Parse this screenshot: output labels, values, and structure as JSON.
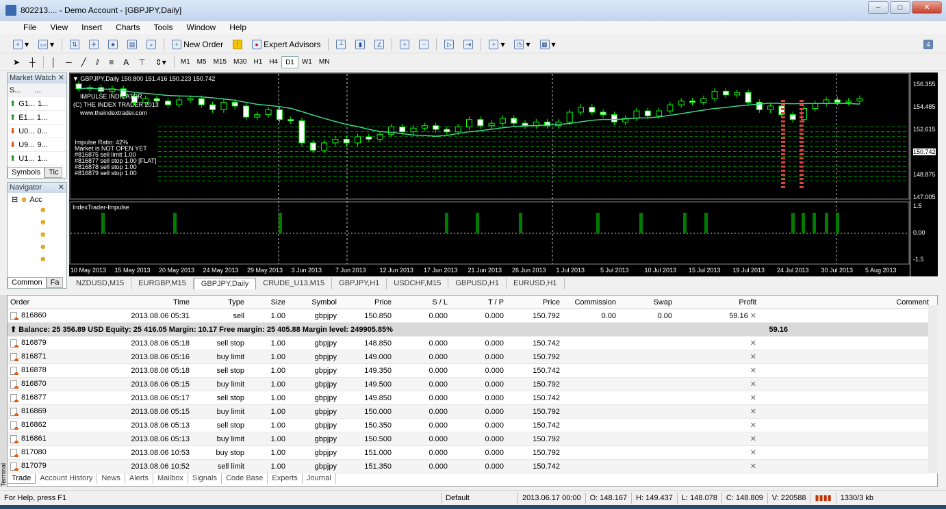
{
  "window": {
    "title": "802213.... - Demo Account - [GBPJPY,Daily]",
    "controls": [
      "–",
      "□",
      "✕"
    ]
  },
  "menu": [
    "File",
    "View",
    "Insert",
    "Charts",
    "Tools",
    "Window",
    "Help"
  ],
  "toolbar1": {
    "new_order": "New Order",
    "expert_advisors": "Expert Advisors"
  },
  "toolbar2": {
    "timeframes": [
      "M1",
      "M5",
      "M15",
      "M30",
      "H1",
      "H4",
      "D1",
      "W1",
      "MN"
    ],
    "selected": "D1",
    "text_tool": "A"
  },
  "market_watch": {
    "title": "Market Watch",
    "col_symbol": "S...",
    "col_price": "...",
    "rows": [
      {
        "sym": "G1...",
        "val": "1...",
        "dir": "up"
      },
      {
        "sym": "E1...",
        "val": "1...",
        "dir": "up"
      },
      {
        "sym": "U0...",
        "val": "0...",
        "dir": "down"
      },
      {
        "sym": "U9...",
        "val": "9...",
        "dir": "down"
      },
      {
        "sym": "U1...",
        "val": "1...",
        "dir": "up"
      }
    ],
    "tabs": [
      "Symbols",
      "Tic"
    ]
  },
  "navigator": {
    "title": "Navigator",
    "root": "Acc",
    "tabs": [
      "Common",
      "Fa"
    ]
  },
  "chart": {
    "header": "GBPJPY,Daily  150.800 151.416 150.223 150.742",
    "indicator_lines": [
      "IMPULSE INDICATOR",
      "(C) THE INDEX TRADER 2013",
      "www.theindextrader.com"
    ],
    "order_labels": [
      "#816879 sell stop 1.00",
      "#816878 sell stop 1.00",
      "#816877 sell stop 1.00 [FLAT]",
      "#816875 sell limit 1.00",
      "Market is NOT OPEN YET",
      "Impulse Ratio: 42%"
    ],
    "sub_title": "IndexTrader-Impulse",
    "price_axis": [
      "156.355",
      "154.485",
      "152.615",
      "150.742",
      "148.875",
      "147.005"
    ],
    "current_price": "150.742",
    "sub_axis": [
      "1.5",
      "0.00",
      "-1.5"
    ],
    "dates": [
      "10 May 2013",
      "15 May 2013",
      "20 May 2013",
      "24 May 2013",
      "29 May 2013",
      "3 Jun 2013",
      "7 Jun 2013",
      "12 Jun 2013",
      "17 Jun 2013",
      "21 Jun 2013",
      "26 Jun 2013",
      "1 Jul 2013",
      "5 Jul 2013",
      "10 Jul 2013",
      "15 Jul 2013",
      "19 Jul 2013",
      "24 Jul 2013",
      "30 Jul 2013",
      "5 Aug 2013"
    ],
    "colors": {
      "bg": "#000000",
      "candle": "#00ff00",
      "ma": "#3cd68c",
      "order_line": "#00c000",
      "impulse": "#007a00"
    }
  },
  "chart_tabs": [
    "NZDUSD,M15",
    "EURGBP,M15",
    "GBPJPY,Daily",
    "CRUDE_U13,M15",
    "GBPJPY,H1",
    "USDCHF,M15",
    "GBPUSD,H1",
    "EURUSD,H1"
  ],
  "chart_tab_active": "GBPJPY,Daily",
  "terminal": {
    "label": "Terminal",
    "headers": [
      "Order",
      "Time",
      "Type",
      "Size",
      "Symbol",
      "Price",
      "S / L",
      "T / P",
      "Price",
      "Commission",
      "Swap",
      "Profit",
      "Comment"
    ],
    "open": {
      "order": "816860",
      "time": "2013.08.06 05:31",
      "type": "sell",
      "size": "1.00",
      "symbol": "gbpjpy",
      "price": "150.850",
      "sl": "0.000",
      "tp": "0.000",
      "cur": "150.792",
      "commission": "0.00",
      "swap": "0.00",
      "profit": "59.16"
    },
    "balance": "Balance: 25 356.89 USD  Equity: 25 416.05  Margin: 10.17  Free margin: 25 405.88  Margin level: 249905.85%",
    "balance_profit": "59.16",
    "pending": [
      {
        "order": "816879",
        "time": "2013.08.06 05:18",
        "type": "sell stop",
        "size": "1.00",
        "symbol": "gbpjpy",
        "price": "148.850",
        "sl": "0.000",
        "tp": "0.000",
        "cur": "150.742"
      },
      {
        "order": "816871",
        "time": "2013.08.06 05:16",
        "type": "buy limit",
        "size": "1.00",
        "symbol": "gbpjpy",
        "price": "149.000",
        "sl": "0.000",
        "tp": "0.000",
        "cur": "150.792"
      },
      {
        "order": "816878",
        "time": "2013.08.06 05:18",
        "type": "sell stop",
        "size": "1.00",
        "symbol": "gbpjpy",
        "price": "149.350",
        "sl": "0.000",
        "tp": "0.000",
        "cur": "150.742"
      },
      {
        "order": "816870",
        "time": "2013.08.06 05:15",
        "type": "buy limit",
        "size": "1.00",
        "symbol": "gbpjpy",
        "price": "149.500",
        "sl": "0.000",
        "tp": "0.000",
        "cur": "150.792"
      },
      {
        "order": "816877",
        "time": "2013.08.06 05:17",
        "type": "sell stop",
        "size": "1.00",
        "symbol": "gbpjpy",
        "price": "149.850",
        "sl": "0.000",
        "tp": "0.000",
        "cur": "150.742"
      },
      {
        "order": "816869",
        "time": "2013.08.06 05:15",
        "type": "buy limit",
        "size": "1.00",
        "symbol": "gbpjpy",
        "price": "150.000",
        "sl": "0.000",
        "tp": "0.000",
        "cur": "150.792"
      },
      {
        "order": "816862",
        "time": "2013.08.06 05:13",
        "type": "sell stop",
        "size": "1.00",
        "symbol": "gbpjpy",
        "price": "150.350",
        "sl": "0.000",
        "tp": "0.000",
        "cur": "150.742"
      },
      {
        "order": "816861",
        "time": "2013.08.06 05:13",
        "type": "buy limit",
        "size": "1.00",
        "symbol": "gbpjpy",
        "price": "150.500",
        "sl": "0.000",
        "tp": "0.000",
        "cur": "150.792"
      },
      {
        "order": "817080",
        "time": "2013.08.06 10:53",
        "type": "buy stop",
        "size": "1.00",
        "symbol": "gbpjpy",
        "price": "151.000",
        "sl": "0.000",
        "tp": "0.000",
        "cur": "150.792"
      },
      {
        "order": "817079",
        "time": "2013.08.06 10:52",
        "type": "sell limit",
        "size": "1.00",
        "symbol": "gbpjpy",
        "price": "151.350",
        "sl": "0.000",
        "tp": "0.000",
        "cur": "150.742"
      }
    ],
    "tabs": [
      "Trade",
      "Account History",
      "News",
      "Alerts",
      "Mailbox",
      "Signals",
      "Code Base",
      "Experts",
      "Journal"
    ],
    "active_tab": "Trade"
  },
  "status": {
    "help": "For Help, press F1",
    "profile": "Default",
    "time": "2013.06.17 00:00",
    "open": "O: 148.167",
    "high": "H: 149.437",
    "low": "L: 148.078",
    "close": "C: 148.809",
    "volume": "V: 220588",
    "traffic": "1330/3 kb"
  }
}
